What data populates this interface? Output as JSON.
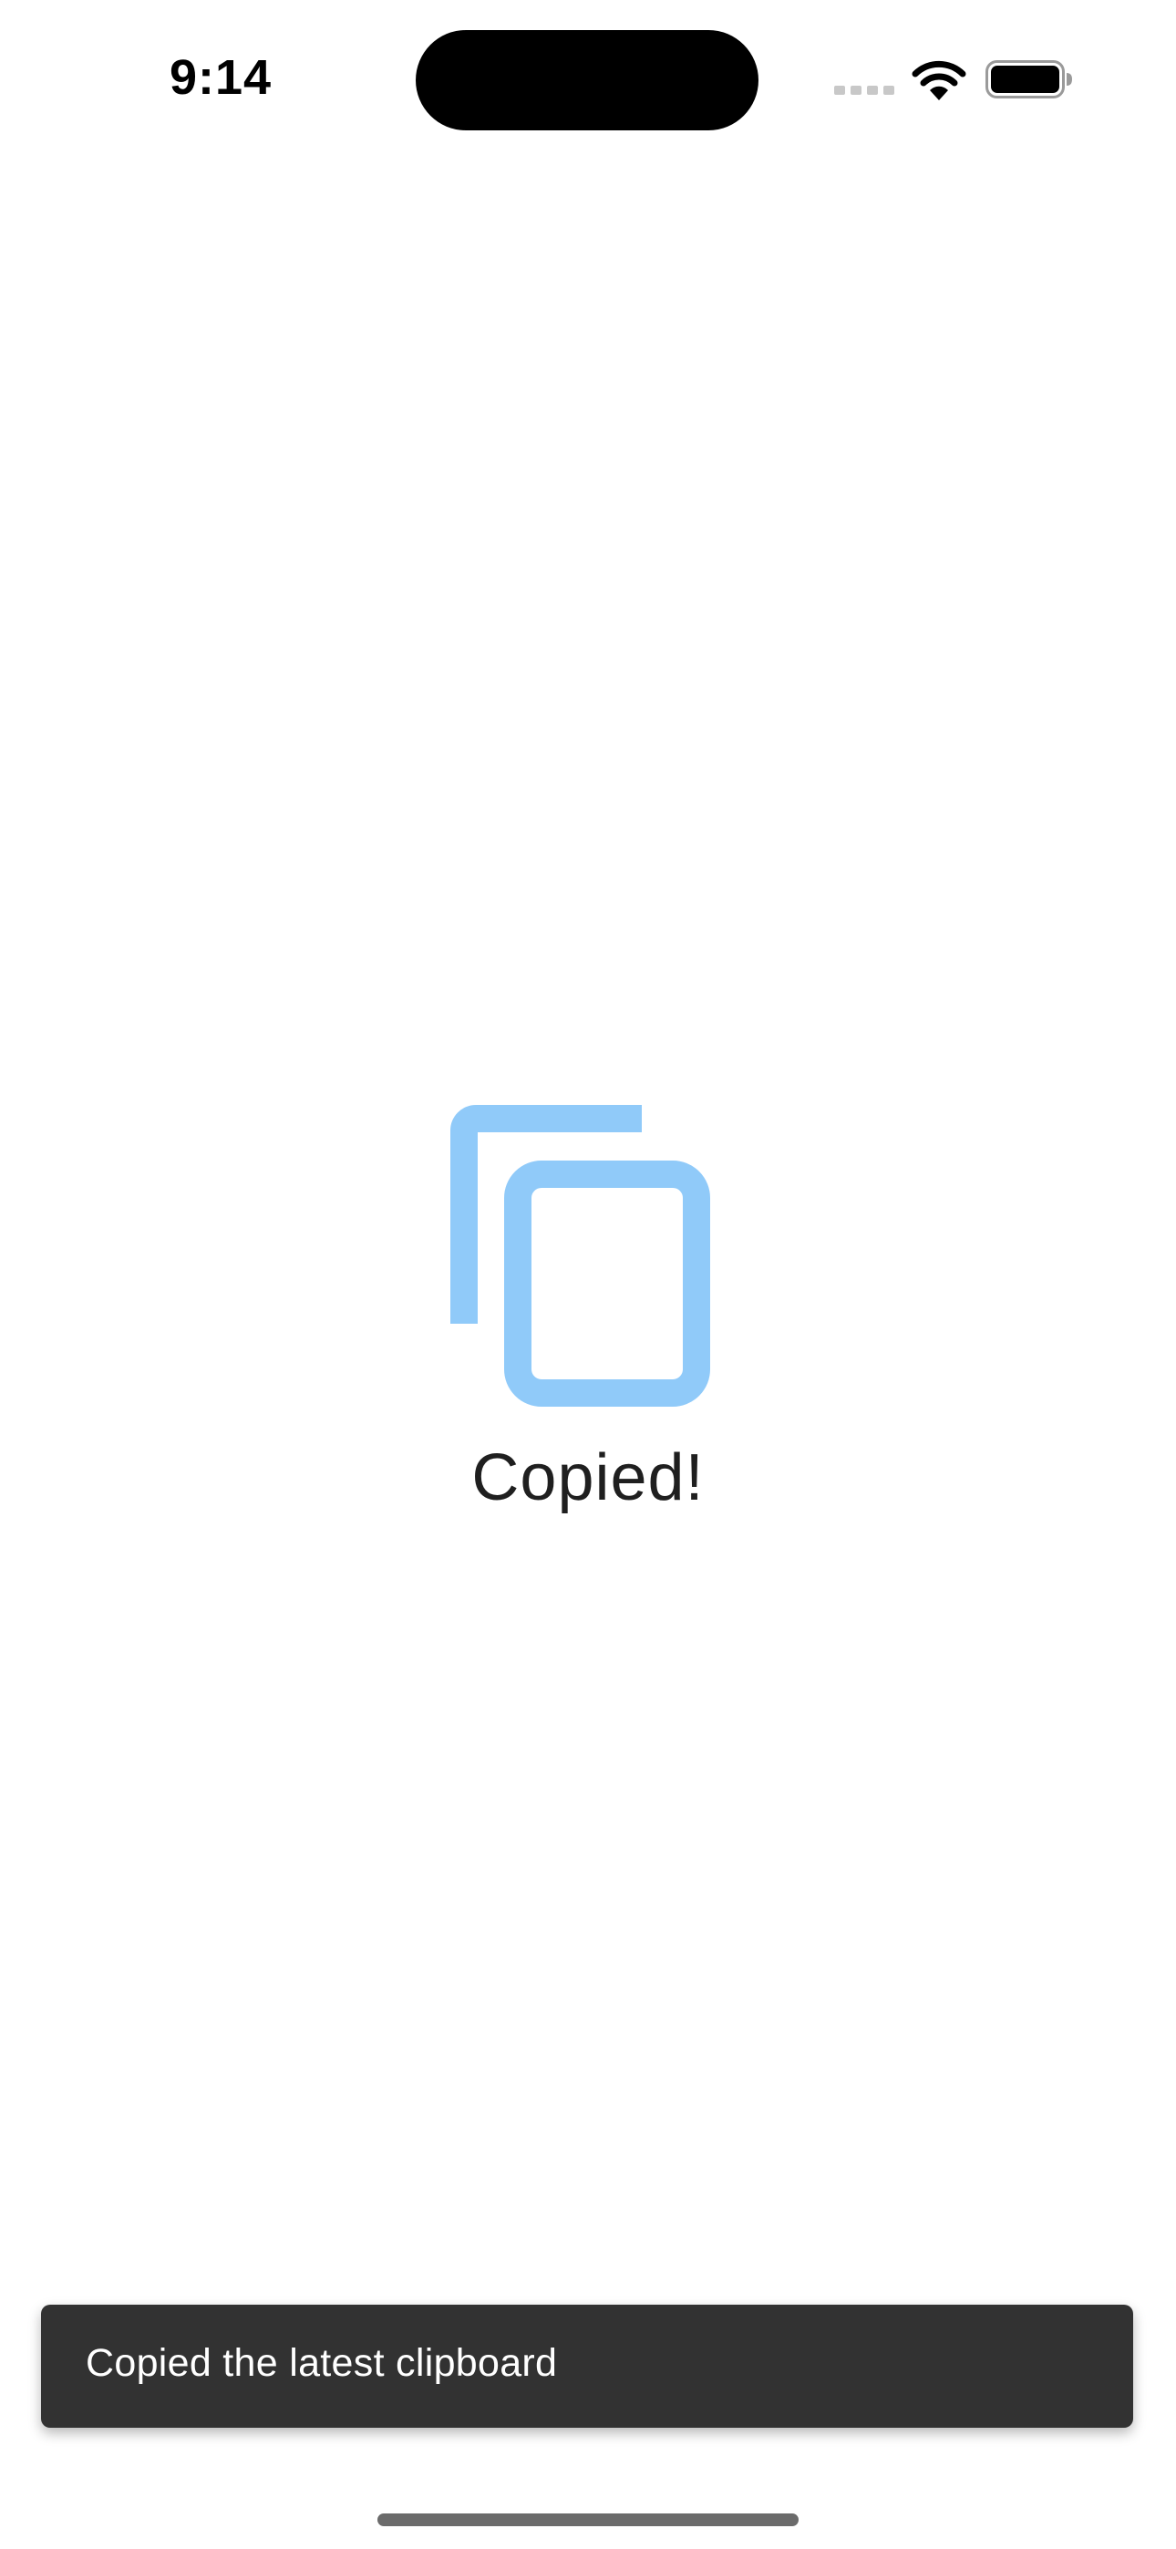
{
  "status_bar": {
    "time": "9:14",
    "icons": [
      "cellular-signal-icon",
      "wifi-icon",
      "battery-icon"
    ]
  },
  "main": {
    "icon": "copy-icon",
    "icon_color": "#90CAF9",
    "message": "Copied!"
  },
  "snackbar": {
    "text": "Copied the latest clipboard",
    "background": "#323232"
  }
}
